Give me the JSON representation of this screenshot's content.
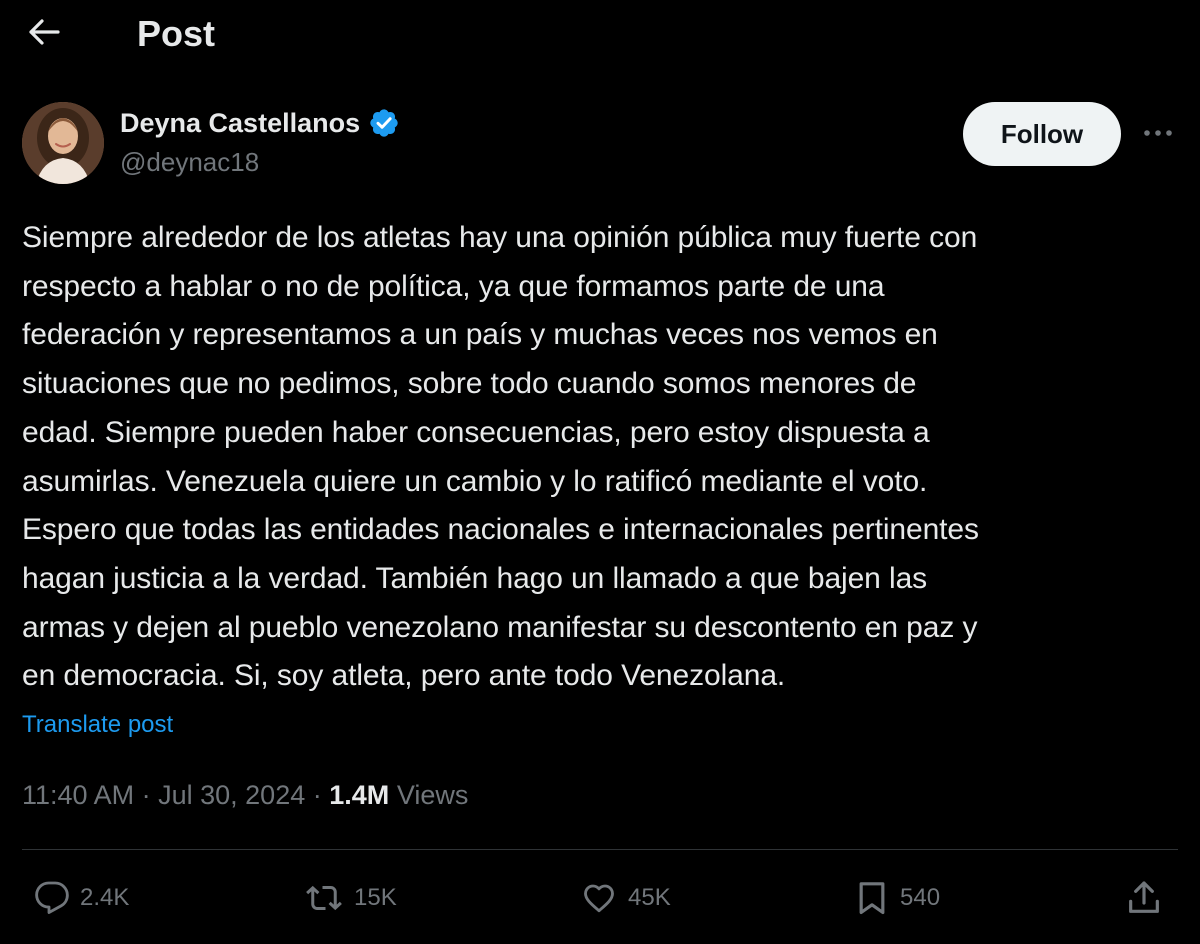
{
  "header": {
    "title": "Post",
    "back_icon": "arrow-left-icon"
  },
  "author": {
    "name": "Deyna Castellanos",
    "handle": "@deynac18",
    "verified": true,
    "verified_color": "#1d9bf0"
  },
  "actions_top": {
    "follow_label": "Follow",
    "more_icon": "more-horizontal-icon"
  },
  "post": {
    "text": "Siempre alrededor de los atletas hay una opinión pública muy fuerte con\nrespecto a hablar o no de política, ya que formamos parte de una\nfederación y representamos a un país y muchas veces nos vemos en\nsituaciones que no pedimos, sobre todo cuando somos menores de\nedad. Siempre pueden haber consecuencias, pero estoy dispuesta a\nasumirlas. Venezuela quiere un cambio y lo ratificó mediante el voto.\nEspero que todas las entidades nacionales e internacionales pertinentes\nhagan justicia a la verdad. También hago un llamado a que bajen las\narmas y dejen al pueblo venezolano manifestar su descontento en paz y\nen democracia. Si, soy atleta, pero ante todo Venezolana.",
    "translate_label": "Translate post",
    "time": "11:40 AM",
    "date": "Jul 30, 2024",
    "views_count": "1.4M",
    "views_label": "Views",
    "separator": "·"
  },
  "engagement": {
    "replies": "2.4K",
    "reposts": "15K",
    "likes": "45K",
    "bookmarks": "540"
  },
  "colors": {
    "background": "#000000",
    "text_primary": "#e7e9ea",
    "text_secondary": "#71767b",
    "accent": "#1d9bf0",
    "divider": "#2f3336",
    "follow_bg": "#eff3f4"
  }
}
